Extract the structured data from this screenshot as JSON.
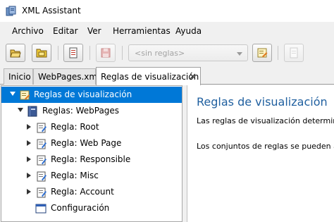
{
  "window": {
    "title": "XML Assistant",
    "icon": "xml-assistant-app-icon"
  },
  "menubar": {
    "items": [
      "Archivo",
      "Editar",
      "Ver",
      "Herramientas",
      "Ayuda"
    ]
  },
  "toolbar": {
    "buttons": [
      {
        "icon": "open-folder-icon",
        "enabled": true
      },
      {
        "icon": "open-folder-yellow-icon",
        "enabled": true
      },
      {
        "icon": "document-edit-icon",
        "enabled": true
      },
      {
        "icon": "save-icon",
        "enabled": false
      },
      {
        "icon": "rules-edit-icon",
        "enabled": true
      },
      {
        "icon": "document-icon",
        "enabled": false
      }
    ],
    "rules_select": {
      "value": "<sin reglas>",
      "enabled": false
    }
  },
  "tabs": [
    {
      "label": "Inicio",
      "active": false
    },
    {
      "label": "WebPages.xml",
      "active": false
    },
    {
      "label": "Reglas de visualización",
      "active": true,
      "closable": true
    }
  ],
  "tree": {
    "root": {
      "label": "Reglas de visualización",
      "icon": "rules-icon",
      "selected": true
    },
    "ruleset": {
      "label": "Reglas: WebPages",
      "icon": "book-icon"
    },
    "rules": [
      {
        "label": "Regla: Root",
        "icon": "rule-icon"
      },
      {
        "label": "Regla: Web Page",
        "icon": "rule-icon"
      },
      {
        "label": "Regla: Responsible",
        "icon": "rule-icon"
      },
      {
        "label": "Regla: Misc",
        "icon": "rule-icon"
      },
      {
        "label": "Regla: Account",
        "icon": "rule-icon"
      }
    ],
    "config": {
      "label": "Configuración",
      "icon": "window-icon"
    }
  },
  "detail": {
    "title": "Reglas de visualización",
    "paragraph1": "Las reglas de visualización determina",
    "paragraph2": "Los conjuntos de reglas se pueden ap"
  },
  "colors": {
    "selection": "#0078d7",
    "heading": "#1f5f9f"
  }
}
